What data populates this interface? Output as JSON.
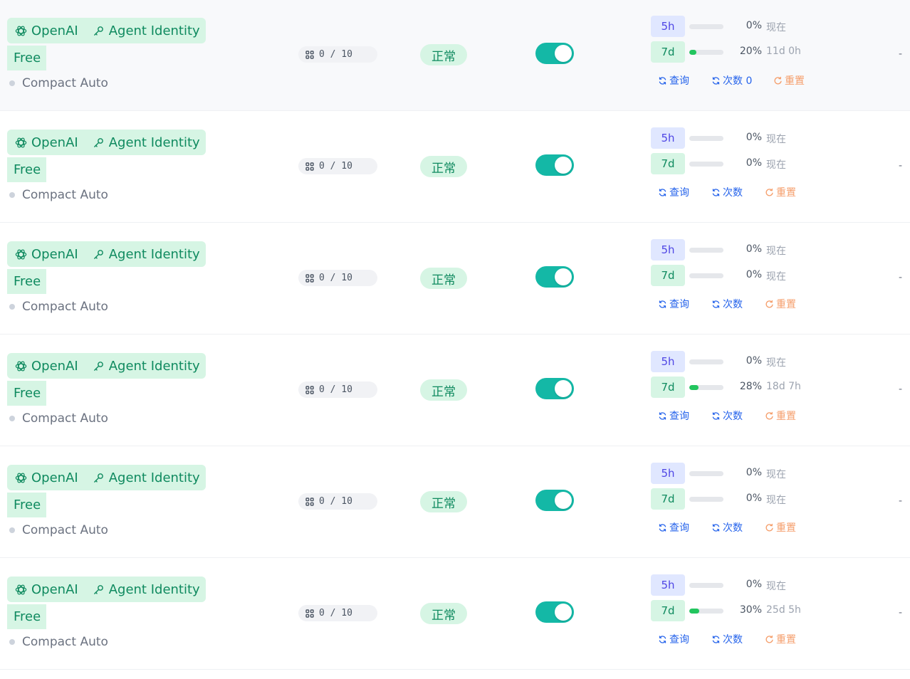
{
  "colors": {
    "accent_teal": "#14b8a6",
    "badge_green": "#d6f5e4",
    "text_green": "#0f8a5f",
    "link_blue": "#2563eb",
    "reset_orange": "#f59e6b"
  },
  "rows": [
    {
      "provider": "OpenAI",
      "auth": "Agent Identity",
      "plan": "Free",
      "mode": "Compact Auto",
      "quota": "0 / 10",
      "status": "正常",
      "enabled": true,
      "win5h_label": "5h",
      "win5h_pct_text": "0%",
      "win5h_pct": 0,
      "win5h_reset": "现在",
      "win7d_label": "7d",
      "win7d_pct_text": "20%",
      "win7d_pct": 20,
      "win7d_reset": "11d 0h",
      "query": "查询",
      "count": "次数 0",
      "reset": "重置",
      "extra": "-"
    },
    {
      "provider": "OpenAI",
      "auth": "Agent Identity",
      "plan": "Free",
      "mode": "Compact Auto",
      "quota": "0 / 10",
      "status": "正常",
      "enabled": true,
      "win5h_label": "5h",
      "win5h_pct_text": "0%",
      "win5h_pct": 0,
      "win5h_reset": "现在",
      "win7d_label": "7d",
      "win7d_pct_text": "0%",
      "win7d_pct": 0,
      "win7d_reset": "现在",
      "query": "查询",
      "count": "次数",
      "reset": "重置",
      "extra": "-"
    },
    {
      "provider": "OpenAI",
      "auth": "Agent Identity",
      "plan": "Free",
      "mode": "Compact Auto",
      "quota": "0 / 10",
      "status": "正常",
      "enabled": true,
      "win5h_label": "5h",
      "win5h_pct_text": "0%",
      "win5h_pct": 0,
      "win5h_reset": "现在",
      "win7d_label": "7d",
      "win7d_pct_text": "0%",
      "win7d_pct": 0,
      "win7d_reset": "现在",
      "query": "查询",
      "count": "次数",
      "reset": "重置",
      "extra": "-"
    },
    {
      "provider": "OpenAI",
      "auth": "Agent Identity",
      "plan": "Free",
      "mode": "Compact Auto",
      "quota": "0 / 10",
      "status": "正常",
      "enabled": true,
      "win5h_label": "5h",
      "win5h_pct_text": "0%",
      "win5h_pct": 0,
      "win5h_reset": "现在",
      "win7d_label": "7d",
      "win7d_pct_text": "28%",
      "win7d_pct": 28,
      "win7d_reset": "18d 7h",
      "query": "查询",
      "count": "次数",
      "reset": "重置",
      "extra": "-"
    },
    {
      "provider": "OpenAI",
      "auth": "Agent Identity",
      "plan": "Free",
      "mode": "Compact Auto",
      "quota": "0 / 10",
      "status": "正常",
      "enabled": true,
      "win5h_label": "5h",
      "win5h_pct_text": "0%",
      "win5h_pct": 0,
      "win5h_reset": "现在",
      "win7d_label": "7d",
      "win7d_pct_text": "0%",
      "win7d_pct": 0,
      "win7d_reset": "现在",
      "query": "查询",
      "count": "次数",
      "reset": "重置",
      "extra": "-"
    },
    {
      "provider": "OpenAI",
      "auth": "Agent Identity",
      "plan": "Free",
      "mode": "Compact Auto",
      "quota": "0 / 10",
      "status": "正常",
      "enabled": true,
      "win5h_label": "5h",
      "win5h_pct_text": "0%",
      "win5h_pct": 0,
      "win5h_reset": "现在",
      "win7d_label": "7d",
      "win7d_pct_text": "30%",
      "win7d_pct": 30,
      "win7d_reset": "25d 5h",
      "query": "查询",
      "count": "次数",
      "reset": "重置",
      "extra": "-"
    }
  ]
}
